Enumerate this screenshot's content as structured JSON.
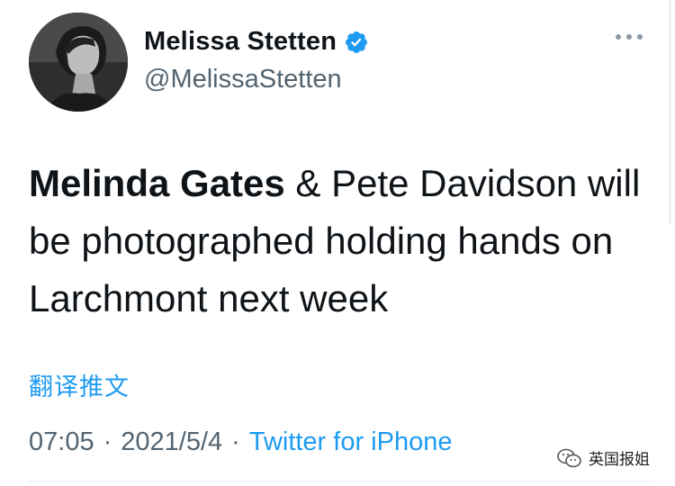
{
  "user": {
    "display_name": "Melissa Stetten",
    "handle": "@MelissaStetten",
    "avatar_icon": "profile-photo-icon",
    "verified_icon": "verified-badge-icon"
  },
  "tweet": {
    "bold_part": "Melinda Gates",
    "rest_part": " & Pete Davidson will be photographed holding hands on Larchmont next week"
  },
  "translate_label": "翻译推文",
  "meta": {
    "time": "07:05",
    "separator": "·",
    "date": "2021/5/4",
    "source": "Twitter for iPhone"
  },
  "watermark": {
    "icon": "wechat-icon",
    "text": "英国报姐"
  },
  "colors": {
    "link": "#1d9bf0",
    "secondary": "#536471",
    "text": "#0f1419"
  }
}
